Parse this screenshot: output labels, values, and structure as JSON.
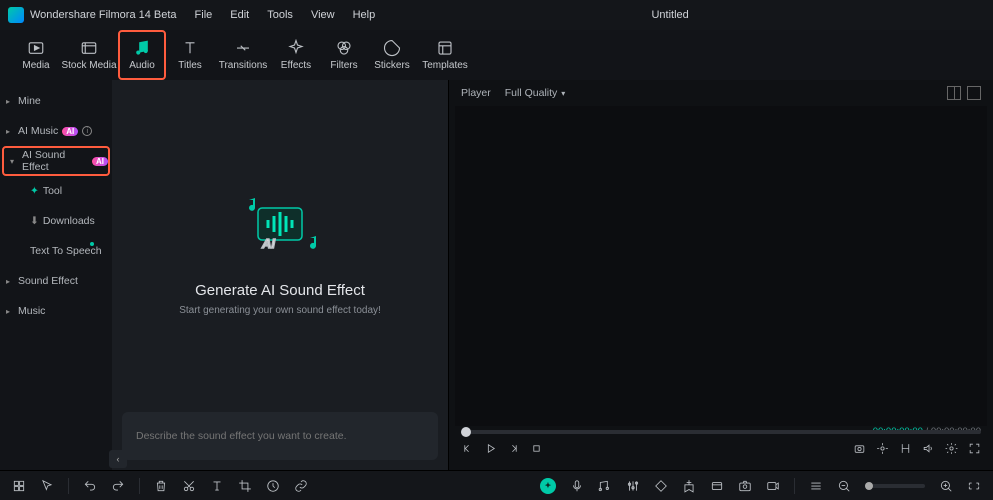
{
  "app": {
    "title": "Wondershare Filmora 14 Beta",
    "project": "Untitled"
  },
  "menu": [
    "File",
    "Edit",
    "Tools",
    "View",
    "Help"
  ],
  "ribbon": [
    {
      "id": "media",
      "label": "Media"
    },
    {
      "id": "stock",
      "label": "Stock Media"
    },
    {
      "id": "audio",
      "label": "Audio",
      "selected": true
    },
    {
      "id": "titles",
      "label": "Titles"
    },
    {
      "id": "transitions",
      "label": "Transitions"
    },
    {
      "id": "effects",
      "label": "Effects"
    },
    {
      "id": "filters",
      "label": "Filters"
    },
    {
      "id": "stickers",
      "label": "Stickers"
    },
    {
      "id": "templates",
      "label": "Templates"
    }
  ],
  "sidebar": {
    "mine": "Mine",
    "aimusic": "AI Music",
    "aisfx": "AI Sound Effect",
    "tool": "Tool",
    "downloads": "Downloads",
    "tts": "Text To Speech",
    "sfx": "Sound Effect",
    "music": "Music"
  },
  "content": {
    "title": "Generate AI Sound Effect",
    "subtitle": "Start generating your own sound effect today!",
    "placeholder": "Describe the sound effect you want to create."
  },
  "player": {
    "label": "Player",
    "quality": "Full Quality",
    "time_current": "00:00:00:00",
    "time_total": "00:00:00:00"
  },
  "badges": {
    "ai": "AI"
  }
}
